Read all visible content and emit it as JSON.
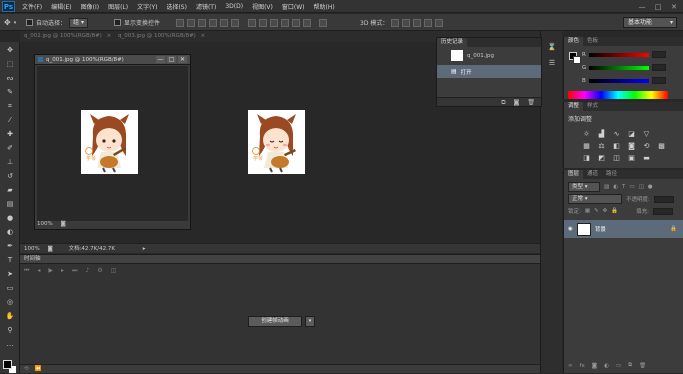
{
  "app": {
    "logo": "Ps"
  },
  "menu": [
    "文件(F)",
    "编辑(E)",
    "图像(I)",
    "图层(L)",
    "文字(Y)",
    "选择(S)",
    "滤镜(T)",
    "3D(D)",
    "视图(V)",
    "窗口(W)",
    "帮助(H)"
  ],
  "window_controls": [
    "—",
    "□",
    "✕"
  ],
  "options_bar": {
    "auto_select_label": "自动选择：",
    "auto_select_value": "组",
    "show_transform_label": "显示变换控件",
    "mode_3d_label": "3D 模式：",
    "workspace": "基本功能"
  },
  "doc_tabs": [
    "q_002.jpg @ 100%(RGB/8#)",
    "q_003.jpg @ 100%(RGB/8#)"
  ],
  "float_window": {
    "title": "q_001.jpg @ 100%(RGB/8#)",
    "zoom": "100%"
  },
  "statusbar": {
    "zoom": "100%",
    "doc": "文档:42.7K/42.7K"
  },
  "timeline": {
    "title": "时间轴",
    "create_button": "创建帧动画",
    "dropdown": "▾"
  },
  "history": {
    "tabs": [
      "历史记录"
    ],
    "snapshot": "q_001.jpg",
    "step": "打开"
  },
  "color_panel": {
    "tabs": [
      "颜色",
      "色板"
    ],
    "channels": [
      "R",
      "G",
      "B"
    ],
    "colors": {
      "r": "#ff3b3b",
      "g": "#3bbf3b",
      "b": "#3b5bff"
    }
  },
  "adjustments": {
    "tabs": [
      "调整",
      "样式"
    ],
    "title": "添加调整"
  },
  "layers": {
    "tabs": [
      "图层",
      "通道",
      "路径"
    ],
    "kind": "类型",
    "blend": "正常",
    "opacity_label": "不透明度:",
    "lock_label": "锁定:",
    "fill_label": "填充:",
    "layer_name": "背景"
  }
}
